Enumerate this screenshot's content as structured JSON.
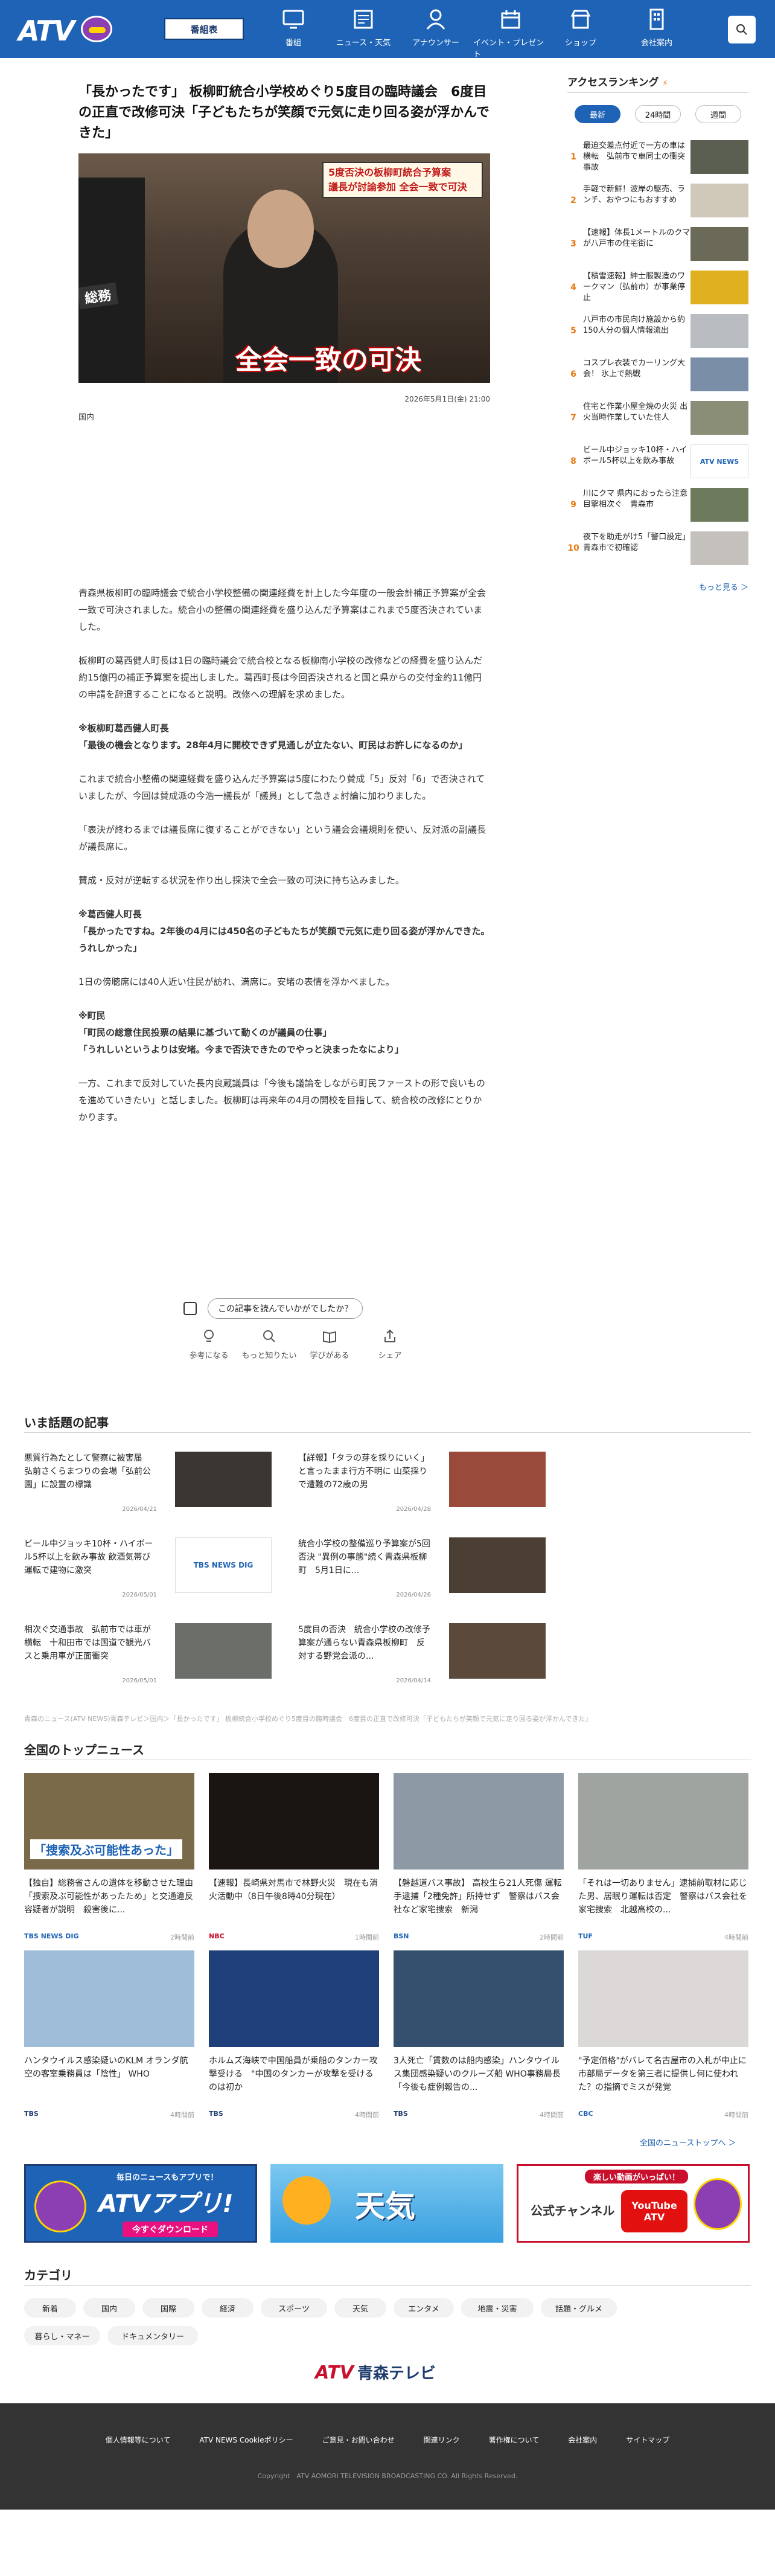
{
  "header": {
    "logo": "ATV",
    "program_table": "番組表",
    "nav": [
      {
        "icon": "tv-icon",
        "label": "番組"
      },
      {
        "icon": "news-icon",
        "label": "ニュース・天気"
      },
      {
        "icon": "announcer-icon",
        "label": "アナウンサー"
      },
      {
        "icon": "event-icon",
        "label": "イベント・プレゼント"
      },
      {
        "icon": "shop-icon",
        "label": "ショップ"
      },
      {
        "icon": "company-icon",
        "label": "会社案内"
      }
    ]
  },
  "article": {
    "title": "「長かったです」 板柳町統合小学校めぐり5度目の臨時議会　6度目の正直で改修可決「子どもたちが笑顔で元気に走り回る姿が浮かんできた」",
    "hero": {
      "badge_line1": "5度否決の板柳町統合予算案",
      "badge_line2": "議長が討論参加 全会一致で可決",
      "caption": "全会一致の可決",
      "tag": "総務"
    },
    "date": "2026年5月1日(金) 21:00",
    "category": "国内",
    "paragraphs": [
      "青森県板柳町の臨時議会で統合小学校整備の関連経費を計上した今年度の一般会計補正予算案が全会一致で可決されました。統合小の整備の関連経費を盛り込んだ予算案はこれまで5度否決されていました。",
      "板柳町の葛西健人町長は1日の臨時議会で統合校となる板柳南小学校の改修などの経費を盛り込んだ約15億円の補正予算案を提出しました。葛西町長は今回否決されると国と県からの交付金約11億円の申請を辞退することになると説明。改修への理解を求めました。",
      "これまで統合小整備の関連経費を盛り込んだ予算案は5度にわたり賛成「5」反対「6」で否決されていましたが、今回は賛成派の今浩一議長が「議員」として急きょ討論に加わりました。",
      "「表決が終わるまでは議長席に復することができない」という議会会議規則を使い、反対派の副議長が議長席に。",
      "賛成・反対が逆転する状況を作り出し採決で全会一致の可決に持ち込みました。",
      "1日の傍聴席には40人近い住民が訪れ、満席に。安堵の表情を浮かべました。",
      "一方、これまで反対していた長内良蔵議員は「今後も議論をしながら町民ファーストの形で良いものを進めていきたい」と話しました。板柳町は再来年の4月の開校を目指して、統合校の改修にとりかかります。"
    ],
    "quote1_head": "※板柳町葛西健人町長",
    "quote1": "「最後の機会となります。28年4月に開校できず見通しが立たない、町民はお許しになるのか」",
    "quote2_head": "※葛西健人町長",
    "quote2": "「長かったですね。2年後の4月には450名の子どもたちが笑顔で元気に走り回る姿が浮かんできた。うれしかった」",
    "quote3_head": "※町民",
    "quote3a": "「町民の総意住民投票の結果に基づいて動くのが議員の仕事」",
    "quote3b": "「うれしいというよりは安堵。今まで否決できたのでやっと決まったなにより」",
    "feedback": "この記事を読んでいかがでしたか？",
    "reactions": [
      {
        "icon": "lightbulb-icon",
        "label": "参考になる"
      },
      {
        "icon": "search-icon",
        "label": "もっと知りたい"
      },
      {
        "icon": "book-icon",
        "label": "学びがある"
      },
      {
        "icon": "share-icon",
        "label": "シェア"
      }
    ]
  },
  "sidebar": {
    "heading": "アクセスランキング",
    "tabs": [
      "最新",
      "24時間",
      "週間"
    ],
    "ranking": [
      {
        "num": "1",
        "text": "最迫交差点付近で一方の車は横転　弘前市で車同士の衝突事故"
      },
      {
        "num": "2",
        "text": "手軽で新鮮！波岸の駆売、ランチ、おやつにもおすすめ"
      },
      {
        "num": "3",
        "text": "【速報】体長1メートルのクマが八戸市の住宅街に"
      },
      {
        "num": "4",
        "text": "【積雪速報】紳士服製造のワークマン（弘前市）が事業停止"
      },
      {
        "num": "5",
        "text": "八戸市の市民向け施設から約150人分の個人情報流出"
      },
      {
        "num": "6",
        "text": "コスプレ衣装でカーリング大会！ 氷上で熱戦"
      },
      {
        "num": "7",
        "text": "住宅と作業小屋全焼の火災 出火当時作業していた住人"
      },
      {
        "num": "8",
        "text": "ビール中ジョッキ10杯・ハイボール5杯以上を飲み事故"
      },
      {
        "num": "9",
        "text": "川にクマ 県内におったら注意 目撃相次ぐ　青森市"
      },
      {
        "num": "10",
        "text": "夜下を助走がけ5「警口設定」青森市で初確認"
      }
    ],
    "more": "もっと見る ＞"
  },
  "topics": {
    "heading": "いま話題の記事",
    "items": [
      {
        "title": "悪質行為たとして警察に被害届　弘前さくらまつりの会場「弘前公園」に設置の標識",
        "date": "2026/04/21"
      },
      {
        "title": "【詳報】「タラの芽を採りにいく」と言ったまま行方不明に 山菜採りで遭難の72歳の男",
        "date": "2026/04/28"
      },
      {
        "title": "ビール中ジョッキ10杯・ハイボール5杯以上を飲み事故 飲酒気帯び運転で建物に激突",
        "date": "2026/05/01"
      },
      {
        "title": "統合小学校の整備巡り予算案が5回否決 \"異例の事態\"続く青森県板柳町　5月1日に...",
        "date": "2026/04/26"
      },
      {
        "title": "相次ぐ交通事故　弘前市では車が横転　十和田市では国道で観光バスと乗用車が正面衝突",
        "date": "2026/05/01"
      },
      {
        "title": "5度目の否決　統合小学校の改修予算案が通らない青森県板柳町　反対する野党会派の...",
        "date": "2026/04/14"
      }
    ],
    "breadcrumb": "青森のニュース(ATV NEWS)青森テレビ＞国内＞「長かったです」 板柳統合小学校めぐり5度目の臨時議会　6度目の正直で改修可決「子どもたちが笑顔で元気に走り回る姿が浮かんできた」"
  },
  "national": {
    "heading": "全国のトップニュース",
    "items": [
      {
        "title": "【独自】総務省さんの遺体を移動させた理由「捜索及ぶ可能性があったため」と交通違反容疑者が説明　殺害後に...",
        "src": "TBS NEWS DIG",
        "date": "2時間前",
        "caption": "「捜索及ぶ可能性あった」"
      },
      {
        "title": "【速報】長崎県対馬市で林野火災　現在も消火活動中（8日午後8時40分現在）",
        "src": "NBC",
        "date": "1時間前"
      },
      {
        "title": "【磐越道バス事故】 高校生ら21人死傷 運転手逮捕「2種免許」所持せず　警察はバス会社など家宅捜索　新潟",
        "src": "BSN",
        "date": "2時間前"
      },
      {
        "title": "「それは一切ありません」逮捕前取材に応じた男、居眠り運転は否定　警察はバス会社を家宅捜索　北越高校の...",
        "src": "TUF",
        "date": "4時間前"
      },
      {
        "title": "ハンタウイルス感染疑いのKLM オランダ航空の客室乗務員は「陰性」 WHO",
        "src": "TBS",
        "date": "4時間前"
      },
      {
        "title": "ホルムズ海峡で中国船員が乗船のタンカー攻撃受ける　\"中国のタンカーが攻撃を受けるのは初か",
        "src": "TBS",
        "date": "4時間前"
      },
      {
        "title": "3人死亡「賃数のは船内感染」ハンタウイルス集団感染疑いのクルーズ船 WHO事務局長「今後も症例報告の...",
        "src": "TBS",
        "date": "4時間前"
      },
      {
        "title": "\"予定価格\"がバレて名古屋市の入札が中止に 市部局データを第三者に提供し何に使われた？の指摘でミスが発覚",
        "src": "CBC",
        "date": "4時間前"
      }
    ],
    "more": "全国のニューストップへ ＞"
  },
  "banners": [
    {
      "line1": "毎日のニュースもアプリで！",
      "line2": "ATVアプリ!",
      "line3": "今すぐダウンロード"
    },
    {
      "line1": "天気"
    },
    {
      "line1": "楽しい動画がいっぱい！",
      "line2": "公式チャンネル",
      "line3": "YouTube ATV"
    }
  ],
  "categories": {
    "heading": "カテゴリ",
    "items": [
      "新着",
      "国内",
      "国際",
      "経済",
      "スポーツ",
      "天気",
      "エンタメ",
      "地震・災害",
      "話題・グルメ",
      "暮らし・マネー",
      "ドキュメンタリー"
    ]
  },
  "footer": {
    "logo": "ATV",
    "logo_sub": "青森テレビ",
    "links": [
      "個人情報等について",
      "ATV NEWS Cookieポリシー",
      "ご意見・お問い合わせ",
      "関連リンク",
      "著作権について",
      "会社案内",
      "サイトマップ"
    ],
    "copyright": "Copyright　ATV AOMORI TELEVISION BROADCASTING CO. All Rights Reserved."
  }
}
